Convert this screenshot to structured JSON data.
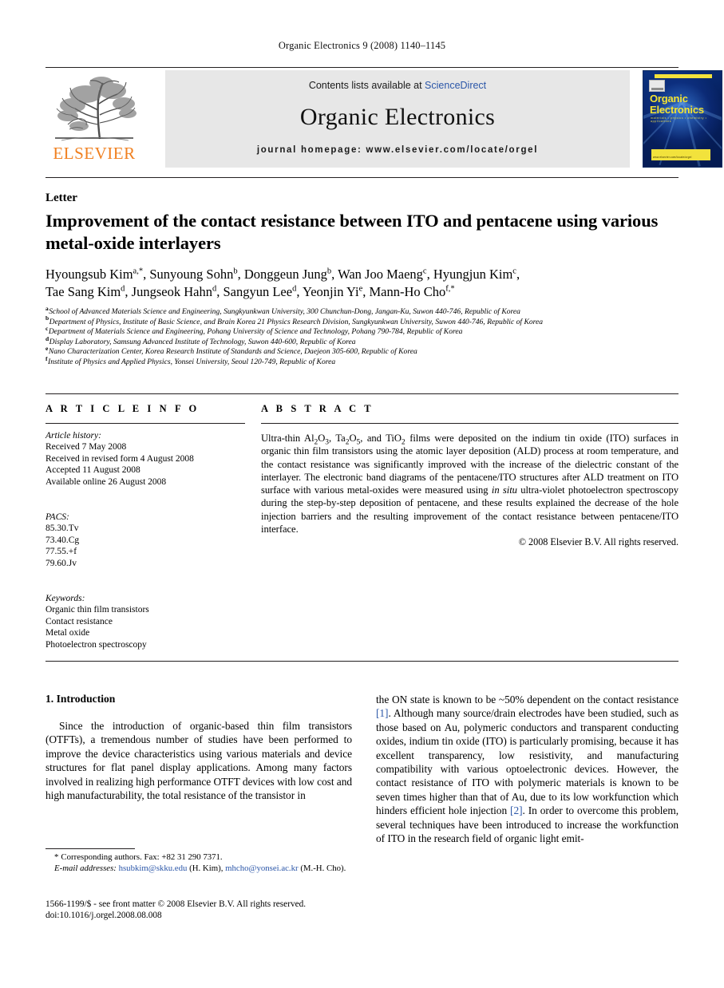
{
  "running_head": "Organic Electronics 9 (2008) 1140–1145",
  "masthead": {
    "contents_prefix": "Contents lists available at ",
    "sciencedirect": "ScienceDirect",
    "journal_title": "Organic Electronics",
    "journal_homepage": "journal homepage: www.elsevier.com/locate/orgel",
    "publisher_wordmark": "ELSEVIER",
    "cover": {
      "title_line1": "Organic",
      "title_line2": "Electronics",
      "subtitle": "materials  •  physics  •  chemistry  •  applications",
      "footer_text": "www.elsevier.com/locate/orgel"
    },
    "colors": {
      "link_blue": "#2b56a8",
      "elsevier_orange": "#f08020",
      "band_grey": "#e7e7e7",
      "cover_blue": "#08286b",
      "cover_yellow": "#f2e23c"
    }
  },
  "article": {
    "doctype": "Letter",
    "title": "Improvement of the contact resistance between ITO and pentacene using various metal-oxide interlayers",
    "authors_line1": [
      {
        "name": "Hyoungsub Kim",
        "marks": "a,*"
      },
      {
        "name": "Sunyoung Sohn",
        "marks": "b"
      },
      {
        "name": "Donggeun Jung",
        "marks": "b"
      },
      {
        "name": "Wan Joo Maeng",
        "marks": "c"
      },
      {
        "name": "Hyungjun Kim",
        "marks": "c"
      }
    ],
    "authors_line2": [
      {
        "name": "Tae Sang Kim",
        "marks": "d"
      },
      {
        "name": "Jungseok Hahn",
        "marks": "d"
      },
      {
        "name": "Sangyun Lee",
        "marks": "d"
      },
      {
        "name": "Yeonjin Yi",
        "marks": "e"
      },
      {
        "name": "Mann-Ho Cho",
        "marks": "f,*"
      }
    ],
    "affiliations": [
      {
        "mark": "a",
        "text": "School of Advanced Materials Science and Engineering, Sungkyunkwan University, 300 Chunchun-Dong, Jangan-Ku, Suwon 440-746, Republic of Korea"
      },
      {
        "mark": "b",
        "text": "Department of Physics, Institute of Basic Science, and Brain Korea 21 Physics Research Division, Sungkyunkwan University, Suwon 440-746, Republic of Korea"
      },
      {
        "mark": "c",
        "text": "Department of Materials Science and Engineering, Pohang University of Science and Technology, Pohang 790-784, Republic of Korea"
      },
      {
        "mark": "d",
        "text": "Display Laboratory, Samsung Advanced Institute of Technology, Suwon 440-600, Republic of Korea"
      },
      {
        "mark": "e",
        "text": "Nano Characterization Center, Korea Research Institute of Standards and Science, Daejeon 305-600, Republic of Korea"
      },
      {
        "mark": "f",
        "text": "Institute of Physics and Applied Physics, Yonsei University, Seoul 120-749, Republic of Korea"
      }
    ]
  },
  "article_info": {
    "heading": "A R T I C L E   I N F O",
    "history_label": "Article history:",
    "history": [
      "Received 7 May 2008",
      "Received in revised form 4 August 2008",
      "Accepted 11 August 2008",
      "Available online 26 August 2008"
    ],
    "pacs_label": "PACS:",
    "pacs": [
      "85.30.Tv",
      "73.40.Cg",
      "77.55.+f",
      "79.60.Jv"
    ],
    "keywords_label": "Keywords:",
    "keywords": [
      "Organic thin film transistors",
      "Contact resistance",
      "Metal oxide",
      "Photoelectron spectroscopy"
    ]
  },
  "abstract": {
    "heading": "A B S T R A C T",
    "copyright": "© 2008 Elsevier B.V. All rights reserved."
  },
  "body": {
    "section1_heading": "1. Introduction",
    "left_paragraph": "Since the introduction of organic-based thin film transistors (OTFTs), a tremendous number of studies have been performed to improve the device characteristics using various materials and device structures for flat panel display applications. Among many factors involved in realizing high performance OTFT devices with low cost and high manufacturability, the total resistance of the transistor in"
  },
  "footnotes": {
    "corresponding": "Corresponding authors. Fax: +82 31 290 7371.",
    "email_label": "E-mail addresses:",
    "email1": "hsubkim@skku.edu",
    "email1_owner": "(H. Kim)",
    "email2": "mhcho@yonsei.ac.kr",
    "email2_owner": "(M.-H. Cho).",
    "issn_line1": "1566-1199/$ - see front matter © 2008 Elsevier B.V. All rights reserved.",
    "issn_line2": "doi:10.1016/j.orgel.2008.08.008"
  }
}
